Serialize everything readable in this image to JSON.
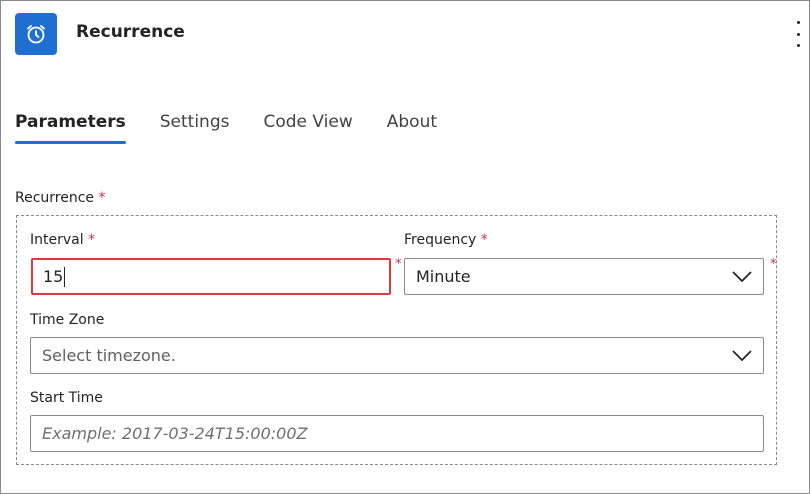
{
  "header": {
    "title": "Recurrence",
    "icon": "alarm-clock-icon",
    "accent_color": "#1f6fd1"
  },
  "tabs": [
    {
      "label": "Parameters",
      "active": true
    },
    {
      "label": "Settings",
      "active": false
    },
    {
      "label": "Code View",
      "active": false
    },
    {
      "label": "About",
      "active": false
    }
  ],
  "form": {
    "recurrence_label": "Recurrence",
    "required_mark": "*",
    "interval": {
      "label": "Interval",
      "value": "15"
    },
    "frequency": {
      "label": "Frequency",
      "value": "Minute"
    },
    "time_zone": {
      "label": "Time Zone",
      "placeholder": "Select timezone."
    },
    "start_time": {
      "label": "Start Time",
      "placeholder": "Example: 2017-03-24T15:00:00Z"
    }
  },
  "colors": {
    "required": "#c4314b",
    "highlight_border": "#e0393e"
  }
}
